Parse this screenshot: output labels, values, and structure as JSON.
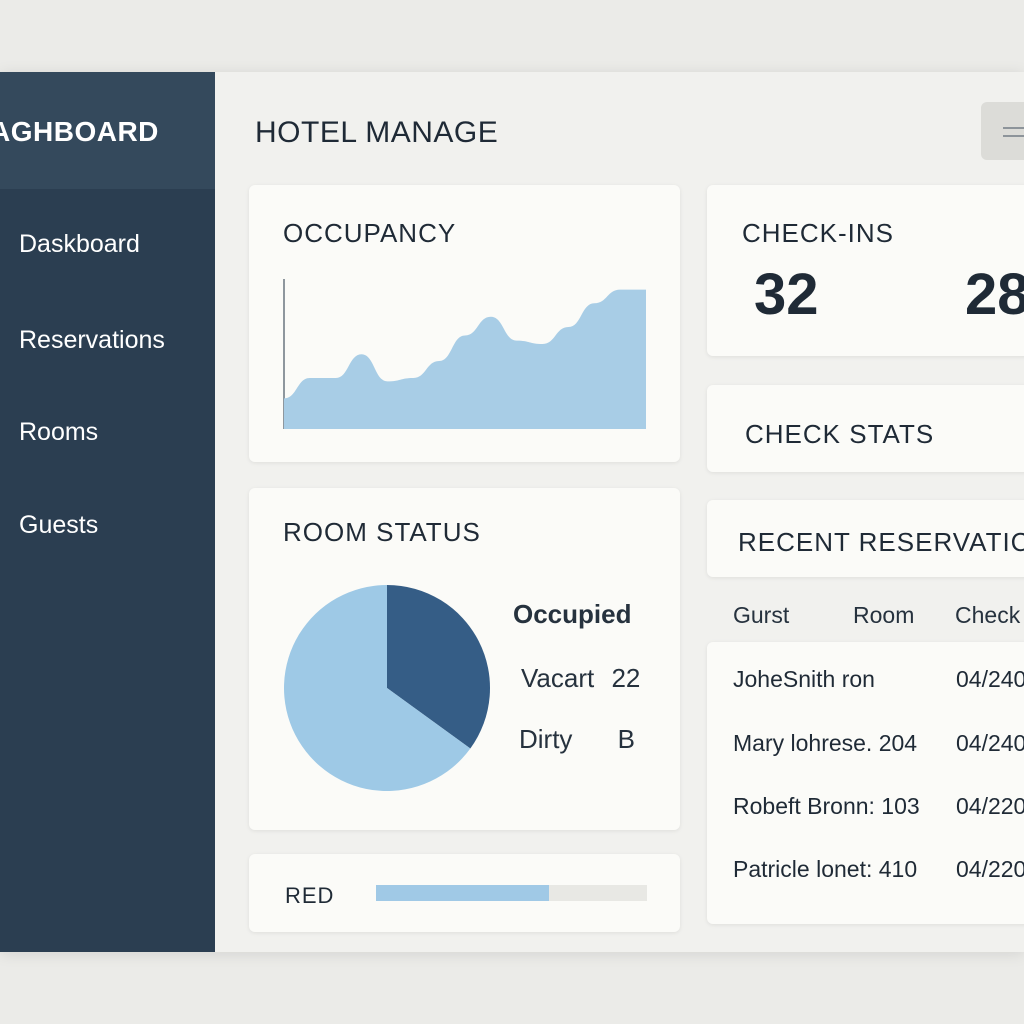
{
  "sidebar": {
    "title": "AGHBOARD",
    "items": [
      {
        "label": "Daskboard"
      },
      {
        "label": "Reservations"
      },
      {
        "label": "Rooms"
      },
      {
        "label": "Guests"
      }
    ]
  },
  "header": {
    "title": "HOTEL MANAGE",
    "menu_icon": "menu-icon"
  },
  "occupancy": {
    "title": "OCCUPANCY",
    "chart_data": {
      "type": "area",
      "x": [
        0,
        1,
        2,
        3,
        4,
        5,
        6,
        7,
        8,
        9,
        10,
        11,
        12,
        13,
        14
      ],
      "y": [
        18,
        30,
        30,
        44,
        28,
        30,
        40,
        55,
        66,
        52,
        50,
        60,
        74,
        82,
        82
      ],
      "title": "",
      "xlabel": "",
      "ylabel": "",
      "ylim": [
        0,
        100
      ],
      "color": "#a8cde6"
    }
  },
  "checkins": {
    "title": "CHECK-INS",
    "value_1": "32",
    "value_2": "28"
  },
  "check_stats": {
    "title": "CHECK STATS"
  },
  "room_status": {
    "title": "ROOM STATUS",
    "legend": [
      {
        "label": "Occupied",
        "value": ""
      },
      {
        "label": "Vacart",
        "value": "22"
      },
      {
        "label": "Dirty",
        "value": "B"
      }
    ],
    "colors": {
      "light": "#9ec9e6",
      "dark": "#355d86"
    },
    "slices": [
      {
        "share": 0.65,
        "color": "#9ec9e6"
      },
      {
        "share": 0.35,
        "color": "#355d86"
      }
    ]
  },
  "red": {
    "label": "RED",
    "progress": 0.64,
    "color": "#a0c9e6"
  },
  "recent_reservations": {
    "title": "RECENT RESERVATIC",
    "columns": [
      "Gurst",
      "Room",
      "Check"
    ],
    "rows": [
      {
        "text": "JoheSnith ron",
        "date": "04/240"
      },
      {
        "text": "Mary lohrese. 204",
        "date": "04/240"
      },
      {
        "text": "Robeft Bronn: 103",
        "date": "04/220"
      },
      {
        "text": "Patricle lonet: 410",
        "date": "04/220"
      }
    ]
  }
}
